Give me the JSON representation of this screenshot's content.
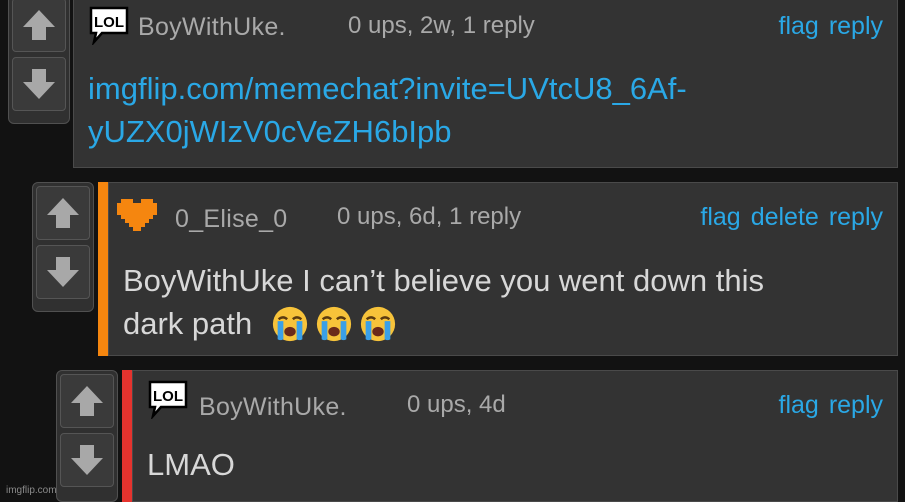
{
  "comments": [
    {
      "username": "BoyWithUke.",
      "meta": "0 ups, 2w, 1 reply",
      "actions": [
        "flag",
        "reply"
      ],
      "text_lines": [
        "imgflip.com/memechat?invite=UVtcU8_6Af-",
        "yUZX0jWIzV0cVeZH6bIpb"
      ],
      "badge": "LOL",
      "badge_icon": "lol-speech-bubble-icon"
    },
    {
      "username": "0_Elise_0",
      "meta": "0 ups, 6d, 1 reply",
      "actions": [
        "flag",
        "delete",
        "reply"
      ],
      "text_lines": [
        "BoyWithUke I can’t believe you went down this",
        "dark path"
      ],
      "emojis": [
        "loudly-crying-face-emoji",
        "loudly-crying-face-emoji",
        "loudly-crying-face-emoji"
      ],
      "badge_icon": "pixel-heart-icon",
      "accent_color": "#f5860f"
    },
    {
      "username": "BoyWithUke.",
      "meta": "0 ups, 4d",
      "actions": [
        "flag",
        "reply"
      ],
      "text_lines": [
        "LMAO"
      ],
      "badge": "LOL",
      "badge_icon": "lol-speech-bubble-icon",
      "accent_color": "#e5332e"
    }
  ],
  "watermark": "imgflip.com",
  "colors": {
    "link": "#2aa8e6",
    "background": "#121212",
    "panel": "#333333"
  }
}
